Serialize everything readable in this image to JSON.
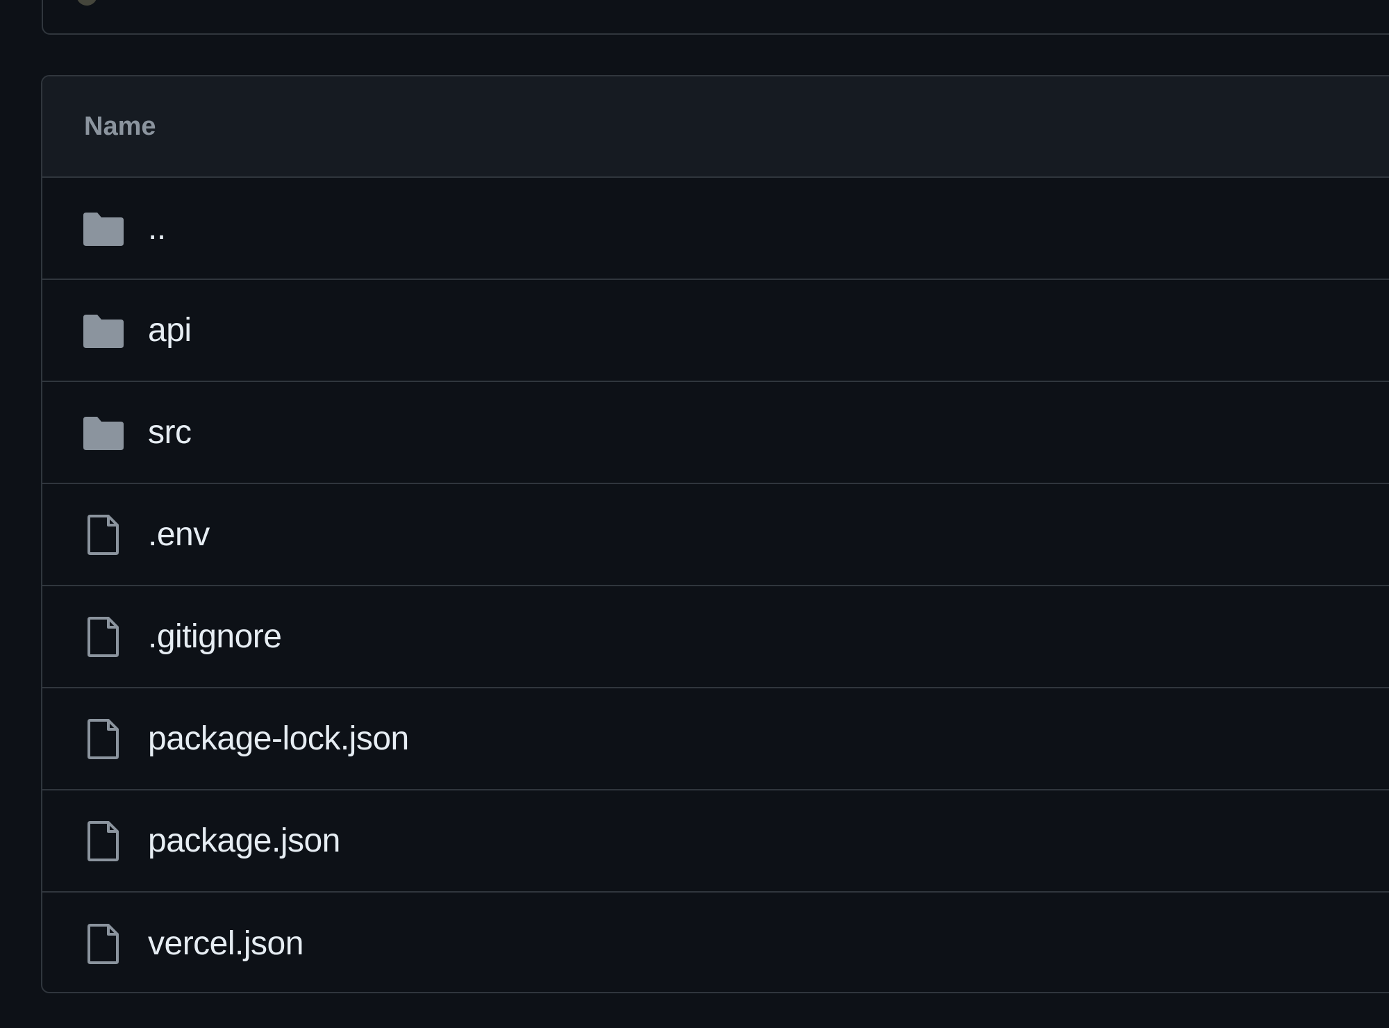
{
  "table": {
    "header": {
      "name_label": "Name"
    },
    "rows": [
      {
        "name": "..",
        "icon": "folder-icon"
      },
      {
        "name": "api",
        "icon": "folder-icon"
      },
      {
        "name": "src",
        "icon": "folder-icon"
      },
      {
        "name": ".env",
        "icon": "file-icon"
      },
      {
        "name": ".gitignore",
        "icon": "file-icon"
      },
      {
        "name": "package-lock.json",
        "icon": "file-icon"
      },
      {
        "name": "package.json",
        "icon": "file-icon"
      },
      {
        "name": "vercel.json",
        "icon": "file-icon"
      }
    ]
  },
  "colors": {
    "background": "#0d1117",
    "header_background": "#161b22",
    "border": "#30363d",
    "icon": "#8b949e",
    "text": "#e6edf3",
    "muted_text": "#8b949e"
  }
}
